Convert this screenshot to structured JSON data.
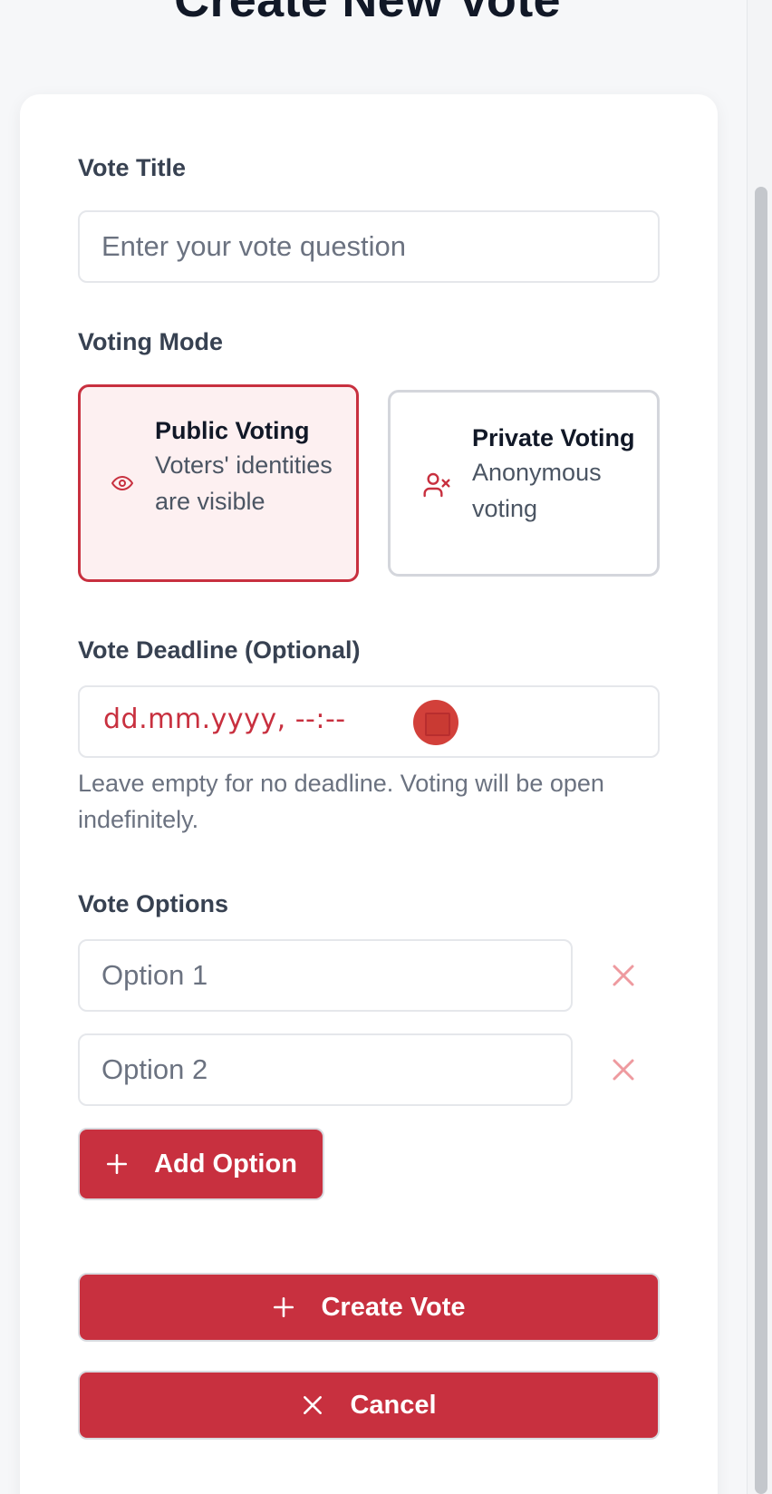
{
  "page": {
    "title": "Create New Vote"
  },
  "form": {
    "title_label": "Vote Title",
    "title_placeholder": "Enter your vote question",
    "mode_label": "Voting Mode",
    "modes": [
      {
        "title": "Public Voting",
        "description": "Voters' identities are visible",
        "icon": "eye-icon",
        "selected": true
      },
      {
        "title": "Private Voting",
        "description": "Anonymous voting",
        "icon": "user-x-icon",
        "selected": false
      }
    ],
    "deadline_label": "Vote Deadline (Optional)",
    "deadline_value": "dd.mm.yyyy, --:--",
    "deadline_help": "Leave empty for no deadline. Voting will be open indefinitely.",
    "options_label": "Vote Options",
    "options": [
      {
        "placeholder": "Option 1"
      },
      {
        "placeholder": "Option 2"
      }
    ],
    "add_option_label": "Add Option",
    "create_label": "Create Vote",
    "cancel_label": "Cancel"
  },
  "colors": {
    "accent": "#c8303f",
    "selected_bg": "#fdf0f1",
    "remove_icon": "#ee9a9f"
  }
}
